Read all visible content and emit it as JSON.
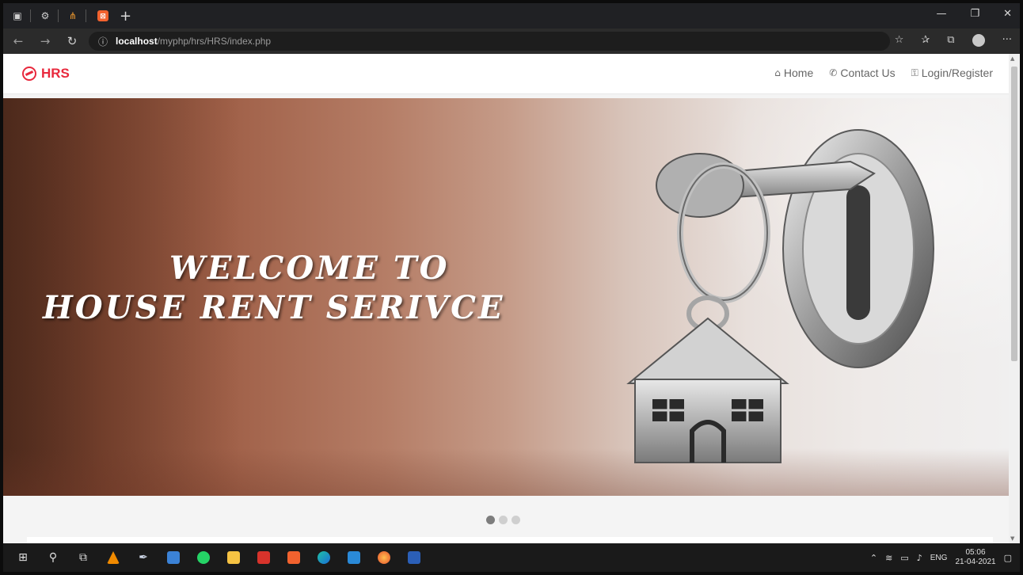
{
  "browser": {
    "tab_favicon_letter": "⊠",
    "address": {
      "host": "localhost",
      "path": "/myphp/hrs/HRS/index.php"
    }
  },
  "site": {
    "brand": "HRS",
    "menu": [
      {
        "icon": "home-icon",
        "label": "Home"
      },
      {
        "icon": "phone-icon",
        "label": "Contact Us"
      },
      {
        "icon": "lock-icon",
        "label": "Login/Register"
      }
    ]
  },
  "hero": {
    "line1": "WELCOME TO",
    "line2": "HOUSE RENT SERIVCE"
  },
  "carousel": {
    "slides": 3,
    "active_index": 0
  },
  "taskbar": {
    "language": "ENG",
    "time": "05:06",
    "date": "21-04-2021"
  },
  "colors": {
    "brand_red": "#e8283c",
    "taskbar_bg": "#1a1a1a",
    "browser_chrome": "#202124"
  }
}
